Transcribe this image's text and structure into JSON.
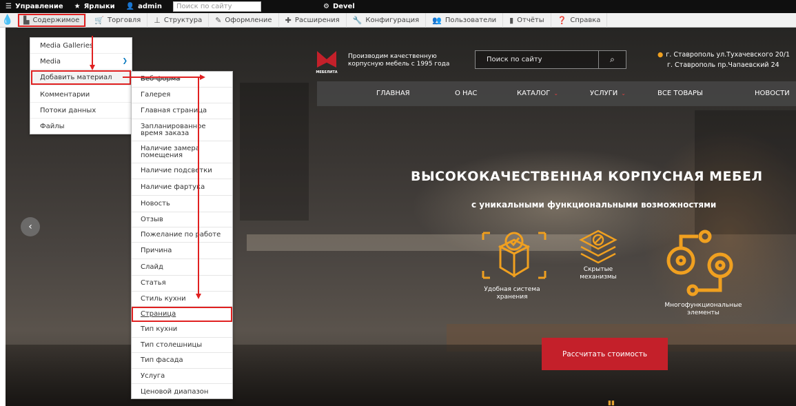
{
  "admin_bar": {
    "manage": "Управление",
    "shortcuts": "Ярлыки",
    "user": "admin",
    "search_placeholder": "Поиск по сайту",
    "devel": "Devel"
  },
  "tray": {
    "items": [
      {
        "label": "Содержимое",
        "icon": "content-icon"
      },
      {
        "label": "Торговля",
        "icon": "commerce-icon"
      },
      {
        "label": "Структура",
        "icon": "structure-icon"
      },
      {
        "label": "Оформление",
        "icon": "appearance-icon"
      },
      {
        "label": "Расширения",
        "icon": "extend-icon"
      },
      {
        "label": "Конфигурация",
        "icon": "configuration-icon"
      },
      {
        "label": "Пользователи",
        "icon": "people-icon"
      },
      {
        "label": "Отчёты",
        "icon": "reports-icon"
      },
      {
        "label": "Справка",
        "icon": "help-icon"
      }
    ]
  },
  "content_menu": {
    "items": [
      "Media Galleries",
      "Media",
      "Добавить материал",
      "Комментарии",
      "Потоки данных",
      "Файлы"
    ]
  },
  "add_content_menu": {
    "items": [
      "Веб-форма",
      "Галерея",
      "Главная страница",
      "Запланированное время заказа",
      "Наличие замера помещения",
      "Наличие подсветки",
      "Наличие фартука",
      "Новость",
      "Отзыв",
      "Пожелание по работе",
      "Причина",
      "Слайд",
      "Статья",
      "Стиль кухни",
      "Страница",
      "Тип кухни",
      "Тип столешницы",
      "Тип фасада",
      "Услуга",
      "Ценовой диапазон"
    ],
    "highlighted": "Страница"
  },
  "site": {
    "logo_text": "МЕБЕЛИТА",
    "tagline": "Производим качественную корпусную мебель с 1995 года",
    "search_placeholder": "Поиск по сайту",
    "address_1": "г. Ставрополь ул.Тухачевского 20/1",
    "address_2": "г. Ставрополь пр.Чапаевский 24",
    "nav": [
      "ГЛАВНАЯ",
      "О НАС",
      "КАТАЛОГ",
      "УСЛУГИ",
      "ВСЕ ТОВАРЫ",
      "НОВОСТИ"
    ],
    "hero_title": "ВЫСОКОКАЧЕСТВЕННАЯ КОРПУСНАЯ МЕБЕЛ",
    "hero_subtitle": "с уникальными функциональными возможностями",
    "features": [
      "Удобная система хранения",
      "Скрытые механизмы",
      "Многофункциональные элементы"
    ],
    "cta": "Рассчитать стоимость"
  },
  "colors": {
    "accent_red": "#c4202a",
    "annotation_red": "#e02020",
    "icon_orange": "#f0a020",
    "drupal_blue": "#0678be"
  }
}
